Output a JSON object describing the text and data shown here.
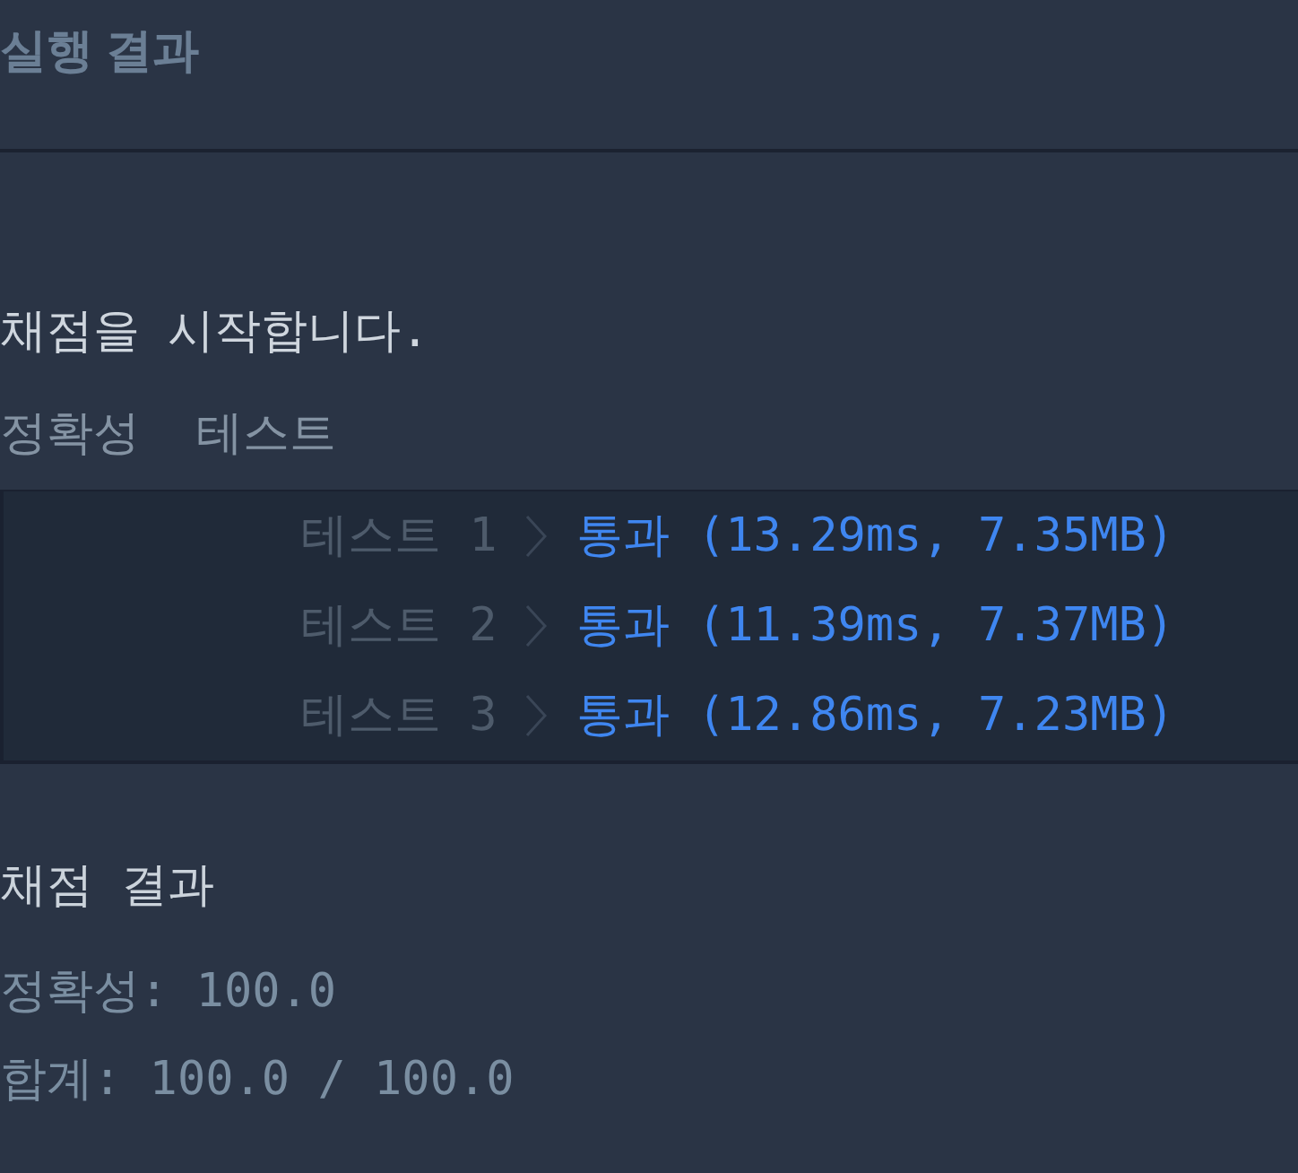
{
  "panel": {
    "title": "실행 결과"
  },
  "output": {
    "message": "채점을 시작합니다.",
    "section_title": "정확성  테스트",
    "tests": [
      {
        "label": "테스트 1",
        "result": "통과 (13.29ms, 7.35MB)"
      },
      {
        "label": "테스트 2",
        "result": "통과 (11.39ms, 7.37MB)"
      },
      {
        "label": "테스트 3",
        "result": "통과 (12.86ms, 7.23MB)"
      }
    ]
  },
  "summary": {
    "title": "채점 결과",
    "lines": [
      "정확성: 100.0",
      "합계: 100.0 / 100.0"
    ]
  }
}
